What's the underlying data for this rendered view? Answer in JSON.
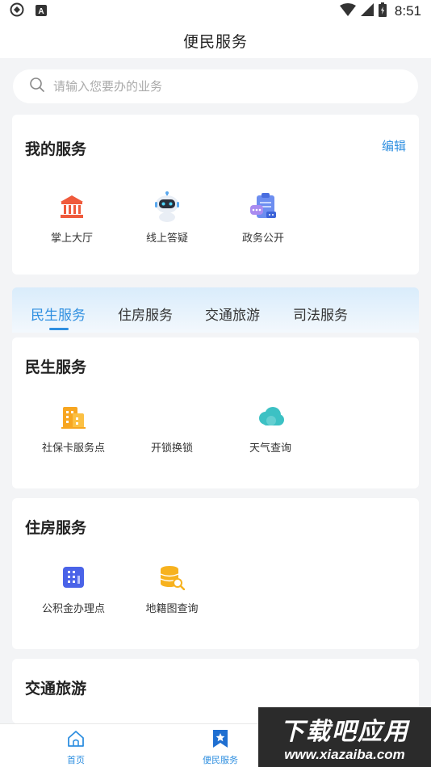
{
  "status_bar": {
    "time": "8:51"
  },
  "header": {
    "title": "便民服务"
  },
  "search": {
    "placeholder": "请输入您要办的业务"
  },
  "my_services": {
    "title": "我的服务",
    "edit_label": "编辑",
    "items": [
      {
        "label": "掌上大厅",
        "icon": "bank-icon"
      },
      {
        "label": "线上答疑",
        "icon": "robot-icon"
      },
      {
        "label": "政务公开",
        "icon": "clipboard-chat-icon"
      }
    ]
  },
  "tabs": [
    {
      "label": "民生服务",
      "active": true
    },
    {
      "label": "住房服务",
      "active": false
    },
    {
      "label": "交通旅游",
      "active": false
    },
    {
      "label": "司法服务",
      "active": false
    }
  ],
  "sections": {
    "livelihood": {
      "title": "民生服务",
      "items": [
        {
          "label": "社保卡服务点",
          "icon": "building-icon"
        },
        {
          "label": "开锁换锁",
          "icon": "lock-icon"
        },
        {
          "label": "天气查询",
          "icon": "cloud-icon"
        }
      ]
    },
    "housing": {
      "title": "住房服务",
      "items": [
        {
          "label": "公积金办理点",
          "icon": "office-building-icon"
        },
        {
          "label": "地籍图查询",
          "icon": "database-search-icon"
        }
      ]
    },
    "transport": {
      "title": "交通旅游"
    }
  },
  "bottom_nav": [
    {
      "label": "首页",
      "icon": "home-icon"
    },
    {
      "label": "便民服务",
      "icon": "bookmark-star-icon"
    }
  ],
  "watermark": {
    "line1": "下载吧应用",
    "line2": "www.xiazaiba.com"
  },
  "colors": {
    "accent": "#2f8fe0",
    "background": "#f3f4f6"
  }
}
